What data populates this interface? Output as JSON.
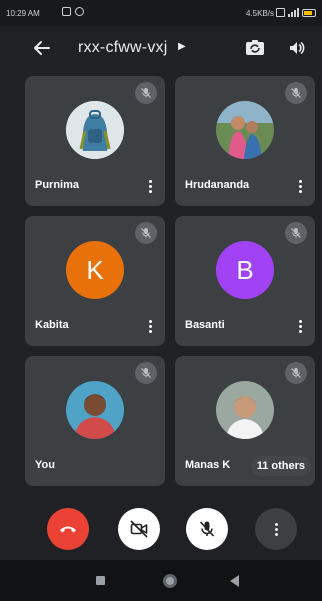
{
  "status_bar": {
    "time": "10:29 AM",
    "network_speed": "4.5KB/s",
    "icons": [
      "message-icon",
      "cast-icon",
      "wifi-icon",
      "signal-icon",
      "battery-icon"
    ]
  },
  "header": {
    "title": "rxx-cfww-vxj",
    "back_icon": "arrow-back-icon",
    "switch_camera_icon": "switch-camera-icon",
    "speaker_icon": "speaker-icon"
  },
  "participants": [
    {
      "name": "Purnima",
      "muted": true,
      "avatar_type": "photo",
      "avatar_bg": "#5f8fae"
    },
    {
      "name": "Hrudananda",
      "muted": true,
      "avatar_type": "photo",
      "avatar_bg": "#6a8c54"
    },
    {
      "name": "Kabita",
      "muted": true,
      "avatar_type": "letter",
      "avatar_letter": "K",
      "avatar_bg": "#e8710a"
    },
    {
      "name": "Basanti",
      "muted": true,
      "avatar_type": "letter",
      "avatar_letter": "B",
      "avatar_bg": "#a142f4"
    },
    {
      "name": "You",
      "muted": true,
      "avatar_type": "photo",
      "avatar_bg": "#4fa3c7"
    },
    {
      "name": "Manas K",
      "muted": true,
      "avatar_type": "photo",
      "avatar_bg": "#7a8b80",
      "others_label": "11 others"
    }
  ],
  "controls": {
    "end_call_icon": "end-call-icon",
    "video_off_icon": "video-off-icon",
    "mic_off_icon": "mic-off-icon",
    "more_icon": "more-options-icon",
    "colors": {
      "end_call": "#ea4335",
      "toggle": "#ffffff",
      "more": "#3c4043"
    }
  },
  "nav_bar": {
    "icons": [
      "recents-icon",
      "home-icon",
      "back-icon"
    ]
  },
  "colors": {
    "background": "#202124",
    "tile": "#3c4043",
    "mute_badge": "#5f6368"
  }
}
